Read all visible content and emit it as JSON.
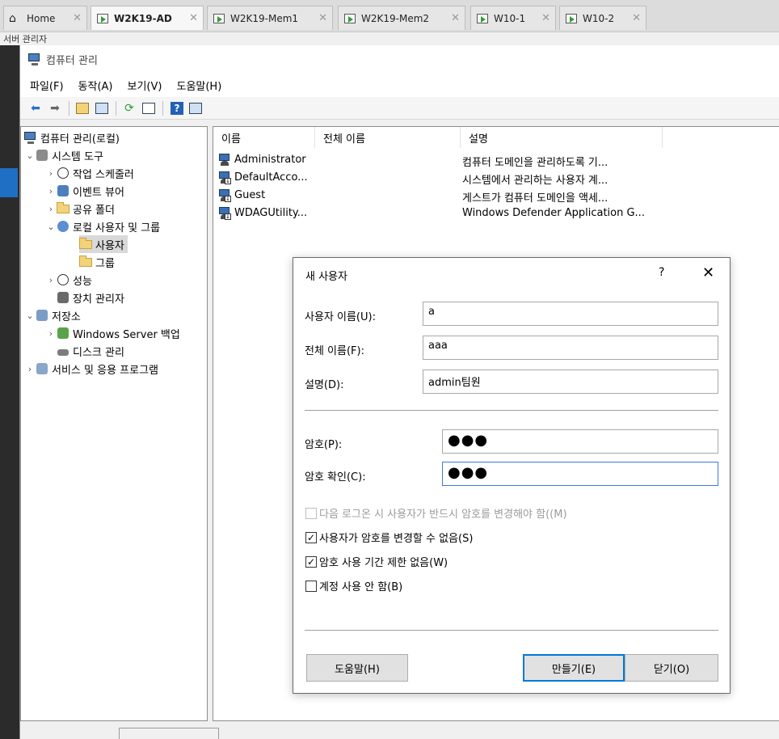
{
  "vm_tabs": [
    {
      "label": "Home",
      "icon": "home-icon",
      "active": false
    },
    {
      "label": "W2K19-AD",
      "icon": "vm-icon",
      "active": true
    },
    {
      "label": "W2K19-Mem1",
      "icon": "vm-icon",
      "active": false
    },
    {
      "label": "W2K19-Mem2",
      "icon": "vm-icon",
      "active": false
    },
    {
      "label": "W10-1",
      "icon": "vm-icon",
      "active": false
    },
    {
      "label": "W10-2",
      "icon": "vm-icon",
      "active": false
    }
  ],
  "background_app_title": "서버 관리자",
  "window": {
    "title": "컴퓨터 관리",
    "menu": [
      "파일(F)",
      "동작(A)",
      "보기(V)",
      "도움말(H)"
    ]
  },
  "tree": [
    {
      "label": "컴퓨터 관리(로컬)",
      "icon": "computer-management-icon"
    },
    {
      "label": "시스템 도구",
      "icon": "tools-icon",
      "expanded": true
    },
    {
      "label": "작업 스케줄러",
      "icon": "clock-icon"
    },
    {
      "label": "이벤트 뷰어",
      "icon": "event-viewer-icon"
    },
    {
      "label": "공유 폴더",
      "icon": "shared-folder-icon"
    },
    {
      "label": "로컬 사용자 및 그룹",
      "icon": "users-groups-icon",
      "expanded": true
    },
    {
      "label": "사용자",
      "icon": "folder-icon",
      "selected": true
    },
    {
      "label": "그룹",
      "icon": "folder-icon"
    },
    {
      "label": "성능",
      "icon": "performance-icon"
    },
    {
      "label": "장치 관리자",
      "icon": "device-manager-icon"
    },
    {
      "label": "저장소",
      "icon": "storage-icon",
      "expanded": true
    },
    {
      "label": "Windows Server 백업",
      "icon": "backup-icon"
    },
    {
      "label": "디스크 관리",
      "icon": "disk-icon"
    },
    {
      "label": "서비스 및 응용 프로그램",
      "icon": "services-icon"
    }
  ],
  "list": {
    "columns": [
      "이름",
      "전체 이름",
      "설명"
    ],
    "rows": [
      {
        "name": "Administrator",
        "full_name": "",
        "description": "컴퓨터 도메인을 관리하도록 기..."
      },
      {
        "name": "DefaultAcco...",
        "full_name": "",
        "description": "시스템에서 관리하는 사용자 계..."
      },
      {
        "name": "Guest",
        "full_name": "",
        "description": "게스트가 컴퓨터 도메인을 액세..."
      },
      {
        "name": "WDAGUtility...",
        "full_name": "",
        "description": "Windows Defender Application G..."
      }
    ]
  },
  "dialog": {
    "title": "새 사용자",
    "help_glyph": "?",
    "close_glyph": "✕",
    "fields": {
      "username": {
        "label": "사용자 이름(U):",
        "value": "a"
      },
      "fullname": {
        "label": "전체 이름(F):",
        "value": "aaa"
      },
      "description": {
        "label": "설명(D):",
        "value": "admin팀원"
      },
      "password": {
        "label": "암호(P):",
        "value": "●●●"
      },
      "confirm": {
        "label": "암호 확인(C):",
        "value": "●●●"
      }
    },
    "checkboxes": [
      {
        "label": "다음 로그온 시 사용자가 반드시 암호를 변경해야 함((M)",
        "checked": false,
        "disabled": true,
        "mark": ""
      },
      {
        "label": "사용자가 암호를 변경할 수 없음(S)",
        "checked": true,
        "disabled": false,
        "mark": "✓"
      },
      {
        "label": "암호 사용 기간 제한 없음(W)",
        "checked": true,
        "disabled": false,
        "mark": "✓"
      },
      {
        "label": "계정 사용 안 함(B)",
        "checked": false,
        "disabled": false,
        "mark": ""
      }
    ],
    "buttons": {
      "help": "도움말(H)",
      "create": "만들기(E)",
      "close": "닫기(O)"
    }
  }
}
